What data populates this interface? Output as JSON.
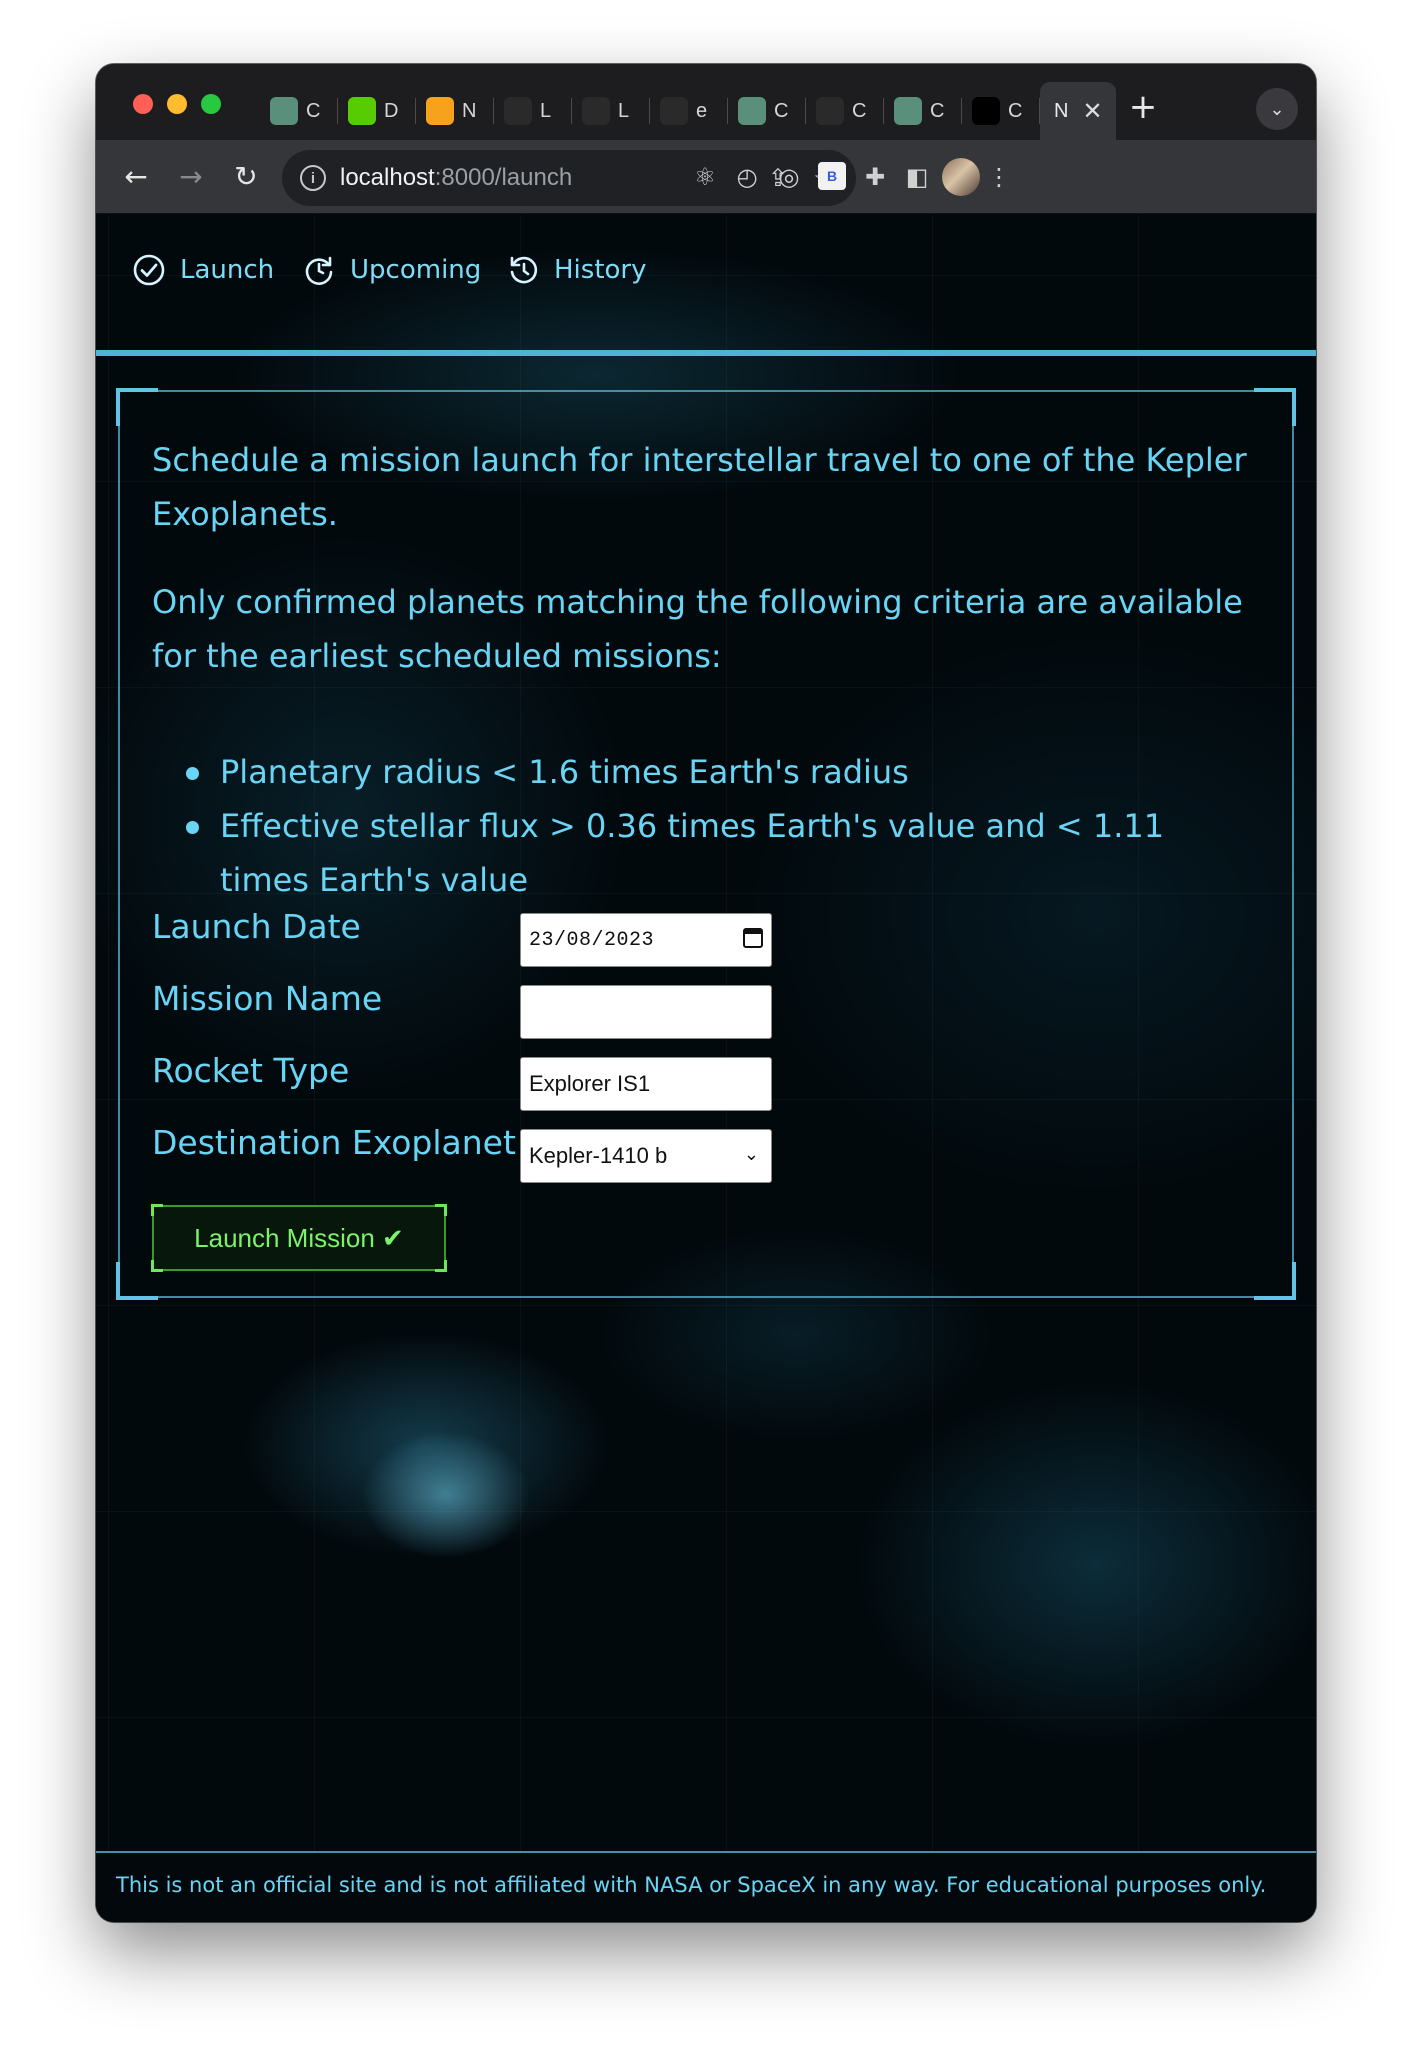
{
  "browser": {
    "tabs": [
      {
        "favicon": "chatgpt-icon",
        "letter": "C",
        "bg": "#5a8f7b"
      },
      {
        "favicon": "duolingo-icon",
        "letter": "D",
        "bg": "#58cc02"
      },
      {
        "favicon": "codepen-icon",
        "letter": "N",
        "bg": "#f7a21c"
      },
      {
        "favicon": "lightning-icon",
        "letter": "L",
        "bg": "#2a2a2a"
      },
      {
        "favicon": "lightning-icon",
        "letter": "L",
        "bg": "#2a2a2a"
      },
      {
        "favicon": "octopus-icon",
        "letter": "e",
        "bg": "#2a2a2a"
      },
      {
        "favicon": "chatgpt-icon",
        "letter": "C",
        "bg": "#5a8f7b"
      },
      {
        "favicon": "react-icon",
        "letter": "C",
        "bg": "#2a2a2a"
      },
      {
        "favicon": "chatgpt-icon",
        "letter": "C",
        "bg": "#5a8f7b"
      },
      {
        "favicon": "triangle-icon",
        "letter": "C",
        "bg": "#000000"
      }
    ],
    "active_tab": {
      "letter": "N",
      "close": "✕"
    },
    "url_host": "localhost",
    "url_path": ":8000/launch",
    "extension_b": "B"
  },
  "nav": {
    "launch": "Launch",
    "upcoming": "Upcoming",
    "history": "History"
  },
  "intro": {
    "p1": "Schedule a mission launch for interstellar travel to one of the Kepler Exoplanets.",
    "p2": "Only confirmed planets matching the following criteria are available for the earliest scheduled missions:"
  },
  "criteria": [
    "Planetary radius < 1.6 times Earth's radius",
    "Effective stellar flux > 0.36 times Earth's value and < 1.11 times Earth's value"
  ],
  "form": {
    "launch_date_label": "Launch Date",
    "launch_date_value": "23/08/2023",
    "mission_name_label": "Mission Name",
    "mission_name_value": "",
    "rocket_type_label": "Rocket Type",
    "rocket_type_value": "Explorer IS1",
    "destination_label": "Destination Exoplanet",
    "destination_value": "Kepler-1410 b",
    "submit_label": "Launch Mission ✔"
  },
  "footer": "This is not an official site and is not affiliated with NASA or SpaceX in any way. For educational purposes only.",
  "colors": {
    "accent": "#6ad4f4",
    "frame": "#63c3e4",
    "submit_text": "#7cf26a",
    "background": "#02090d"
  }
}
